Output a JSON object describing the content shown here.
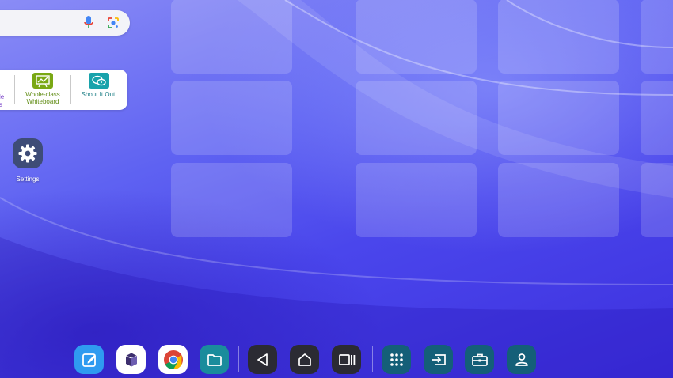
{
  "search": {
    "mic_icon": "microphone-icon",
    "lens_icon": "google-lens-icon"
  },
  "apps_widget": {
    "partial_label_line1": "le",
    "partial_label_line2": "s",
    "whiteboard_label": "Whole-class Whiteboard",
    "whiteboard_icon": "whiteboard-icon",
    "whiteboard_color": "#7aa814",
    "shout_label": "Shout It Out!",
    "shout_icon": "shout-it-out-icon",
    "shout_color": "#19a3ab"
  },
  "desktop": {
    "settings_label": "Settings",
    "settings_icon": "gear-icon"
  },
  "dock": {
    "apps": [
      {
        "name": "notes-app",
        "icon": "pencil-square-icon",
        "color": "#2f9bf0"
      },
      {
        "name": "cube-app",
        "icon": "cube-icon",
        "color": "#ffffff"
      },
      {
        "name": "chrome",
        "icon": "chrome-icon",
        "color": "#ffffff"
      },
      {
        "name": "files",
        "icon": "folder-icon",
        "color": "#1a8c9c"
      }
    ],
    "navigation": [
      {
        "name": "back",
        "icon": "triangle-back-icon",
        "color": "#2b2b33"
      },
      {
        "name": "home",
        "icon": "home-icon",
        "color": "#2b2b33"
      },
      {
        "name": "recents",
        "icon": "recents-icon",
        "color": "#2b2b33"
      }
    ],
    "tools": [
      {
        "name": "app-drawer",
        "icon": "grid-dots-icon",
        "color": "#145f78"
      },
      {
        "name": "input-source",
        "icon": "input-source-icon",
        "color": "#145f78"
      },
      {
        "name": "toolbox",
        "icon": "toolbox-icon",
        "color": "#145f78"
      },
      {
        "name": "account",
        "icon": "user-icon",
        "color": "#145f78"
      }
    ]
  }
}
